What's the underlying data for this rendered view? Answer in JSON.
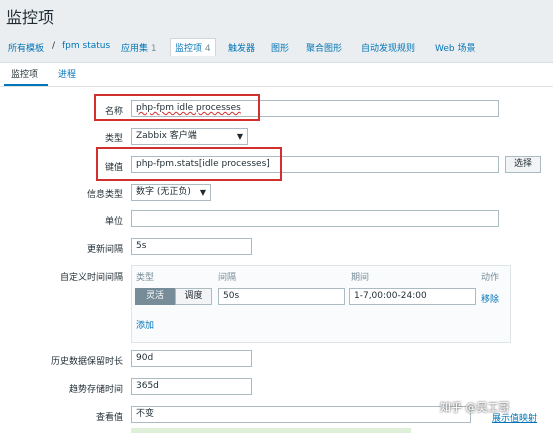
{
  "page": {
    "title": "监控项"
  },
  "breadcrumbs": [
    {
      "label": "所有模板"
    },
    {
      "sep": "/"
    },
    {
      "label": "fpm status"
    },
    {
      "label": "应用集",
      "count": "1"
    },
    {
      "label": "监控项",
      "count": "4"
    },
    {
      "label": "触发器"
    },
    {
      "label": "图形"
    },
    {
      "label": "聚合图形"
    },
    {
      "label": "自动发现规则"
    },
    {
      "label": "Web 场景"
    }
  ],
  "tabs": [
    {
      "label": "监控项"
    },
    {
      "label": "进程"
    }
  ],
  "form": {
    "name": {
      "label": "名称",
      "value": "php-fpm idle processes"
    },
    "type": {
      "label": "类型",
      "value": "Zabbix 客户端"
    },
    "key": {
      "label": "键值",
      "value": "php-fpm.stats[idle processes]",
      "button": "选择"
    },
    "info_type": {
      "label": "信息类型",
      "value": "数字 (无正负)"
    },
    "units": {
      "label": "单位",
      "value": ""
    },
    "interval": {
      "label": "更新间隔",
      "value": "5s"
    },
    "custom_intervals": {
      "label": "自定义时间间隔",
      "headers": {
        "type": "类型",
        "interval": "间隔",
        "period": "期间",
        "action": "动作"
      },
      "row": {
        "flexible": "灵活",
        "scheduling": "调度",
        "interval": "50s",
        "period": "1-7,00:00-24:00",
        "remove": "移除"
      },
      "add": "添加"
    },
    "history": {
      "label": "历史数据保留时长",
      "value": "90d"
    },
    "trends": {
      "label": "趋势存储时间",
      "value": "365d"
    },
    "show_value": {
      "label": "查看值",
      "value": "不变",
      "help": "展示值映射"
    }
  },
  "watermark": "知乎 @吴工哥",
  "colors": {
    "link": "#0275b8",
    "highlight": "#d22f2f",
    "segment_active": "#768d99"
  }
}
